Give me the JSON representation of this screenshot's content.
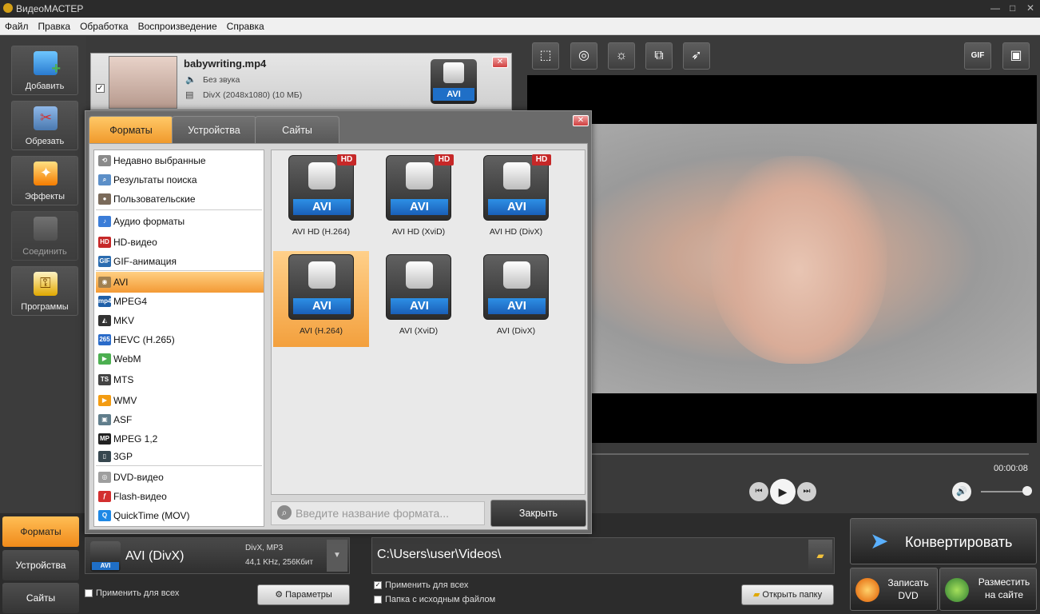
{
  "app": {
    "title": "ВидеоМАСТЕР"
  },
  "menu": [
    "Файл",
    "Правка",
    "Обработка",
    "Воспроизведение",
    "Справка"
  ],
  "left_buttons": [
    {
      "label": "Добавить",
      "enabled": true
    },
    {
      "label": "Обрезать",
      "enabled": true
    },
    {
      "label": "Эффекты",
      "enabled": true
    },
    {
      "label": "Соединить",
      "enabled": false
    },
    {
      "label": "Программы",
      "enabled": true
    }
  ],
  "file": {
    "name": "babywriting.mp4",
    "audio": "Без звука",
    "video": "DivX (2048x1080) (10 МБ)",
    "badge": "AVI"
  },
  "dialog": {
    "tabs": [
      "Форматы",
      "Устройства",
      "Сайты"
    ],
    "categories": [
      {
        "label": "Недавно выбранные",
        "icon": "clock"
      },
      {
        "label": "Результаты поиска",
        "icon": "search"
      },
      {
        "label": "Пользовательские",
        "icon": "user"
      },
      {
        "label": "Аудио форматы",
        "icon": "note"
      },
      {
        "label": "HD-видео",
        "icon": "HD"
      },
      {
        "label": "GIF-анимация",
        "icon": "GIF"
      },
      {
        "label": "AVI",
        "icon": "reel"
      },
      {
        "label": "MPEG4",
        "icon": "mp4"
      },
      {
        "label": "MKV",
        "icon": "mkv"
      },
      {
        "label": "HEVC (H.265)",
        "icon": "265"
      },
      {
        "label": "WebM",
        "icon": "play"
      },
      {
        "label": "MTS",
        "icon": "mts"
      },
      {
        "label": "WMV",
        "icon": "wmv"
      },
      {
        "label": "ASF",
        "icon": "asf"
      },
      {
        "label": "MPEG 1,2",
        "icon": "mpeg"
      },
      {
        "label": "3GP",
        "icon": "3gp"
      },
      {
        "label": "DVD-видео",
        "icon": "dvd"
      },
      {
        "label": "Flash-видео",
        "icon": "flash"
      },
      {
        "label": "QuickTime (MOV)",
        "icon": "qt"
      }
    ],
    "formats": [
      {
        "label": "AVI HD (H.264)",
        "badge": "AVI",
        "hd": "HD"
      },
      {
        "label": "AVI HD (XviD)",
        "badge": "AVI",
        "hd": "HD"
      },
      {
        "label": "AVI HD (DivX)",
        "badge": "AVI",
        "hd": "HD"
      },
      {
        "label": "AVI (H.264)",
        "badge": "AVI",
        "hd": ""
      },
      {
        "label": "AVI (XviD)",
        "badge": "AVI",
        "hd": ""
      },
      {
        "label": "AVI (DivX)",
        "badge": "AVI",
        "hd": ""
      }
    ],
    "search_placeholder": "Введите название формата...",
    "close": "Закрыть"
  },
  "player": {
    "time": "00:00:08",
    "gif": "GIF"
  },
  "bottom_tabs": [
    "Форматы",
    "Устройства",
    "Сайты"
  ],
  "output": {
    "format": "AVI (DivX)",
    "codec": "DivX, MP3",
    "audio": "44,1 KHz, 256Кбит",
    "badge": "AVI",
    "apply_all": "Применить для всех",
    "params": "Параметры"
  },
  "path": {
    "value": "C:\\Users\\user\\Videos\\",
    "apply_all": "Применить для всех",
    "source_folder": "Папка с исходным файлом",
    "open_folder": "Открыть папку"
  },
  "actions": {
    "convert": "Конвертировать",
    "dvd_line1": "Записать",
    "dvd_line2": "DVD",
    "web_line1": "Разместить",
    "web_line2": "на сайте"
  }
}
